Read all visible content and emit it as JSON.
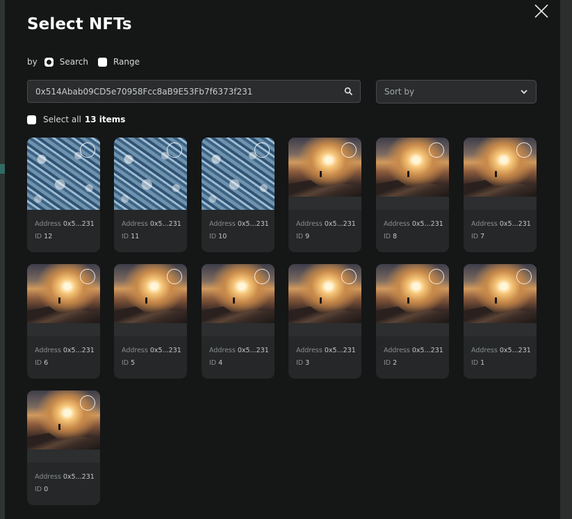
{
  "modal": {
    "title": "Select NFTs",
    "close_icon": "close-icon"
  },
  "filter": {
    "by_label": "by",
    "options": [
      {
        "label": "Search",
        "selected": true
      },
      {
        "label": "Range",
        "selected": false
      }
    ]
  },
  "search": {
    "value": "0x514Abab09CD5e70958Fcc8aB9E53Fb7f6373f231",
    "placeholder": "",
    "icon": "search-icon"
  },
  "sort": {
    "label": "Sort by",
    "icon": "chevron-down-icon"
  },
  "select_all": {
    "label": "Select all",
    "count": "13 items",
    "checked": false
  },
  "nfts": [
    {
      "address_label": "Address",
      "address": "0x5...231",
      "id_label": "ID",
      "id": "12",
      "image": "waves"
    },
    {
      "address_label": "Address",
      "address": "0x5...231",
      "id_label": "ID",
      "id": "11",
      "image": "waves"
    },
    {
      "address_label": "Address",
      "address": "0x5...231",
      "id_label": "ID",
      "id": "10",
      "image": "waves"
    },
    {
      "address_label": "Address",
      "address": "0x5...231",
      "id_label": "ID",
      "id": "9",
      "image": "sunset"
    },
    {
      "address_label": "Address",
      "address": "0x5...231",
      "id_label": "ID",
      "id": "8",
      "image": "sunset"
    },
    {
      "address_label": "Address",
      "address": "0x5...231",
      "id_label": "ID",
      "id": "7",
      "image": "sunset"
    },
    {
      "address_label": "Address",
      "address": "0x5...231",
      "id_label": "ID",
      "id": "6",
      "image": "sunset"
    },
    {
      "address_label": "Address",
      "address": "0x5...231",
      "id_label": "ID",
      "id": "5",
      "image": "sunset"
    },
    {
      "address_label": "Address",
      "address": "0x5...231",
      "id_label": "ID",
      "id": "4",
      "image": "sunset"
    },
    {
      "address_label": "Address",
      "address": "0x5...231",
      "id_label": "ID",
      "id": "3",
      "image": "sunset"
    },
    {
      "address_label": "Address",
      "address": "0x5...231",
      "id_label": "ID",
      "id": "2",
      "image": "sunset"
    },
    {
      "address_label": "Address",
      "address": "0x5...231",
      "id_label": "ID",
      "id": "1",
      "image": "sunset"
    },
    {
      "address_label": "Address",
      "address": "0x5...231",
      "id_label": "ID",
      "id": "0",
      "image": "sunset"
    }
  ],
  "colors": {
    "modal_bg": "#151616",
    "card_bg": "#252728",
    "input_bg": "#2a2c2d",
    "border": "#484b4c",
    "text": "#ffffff",
    "muted": "#8a8e8e"
  }
}
